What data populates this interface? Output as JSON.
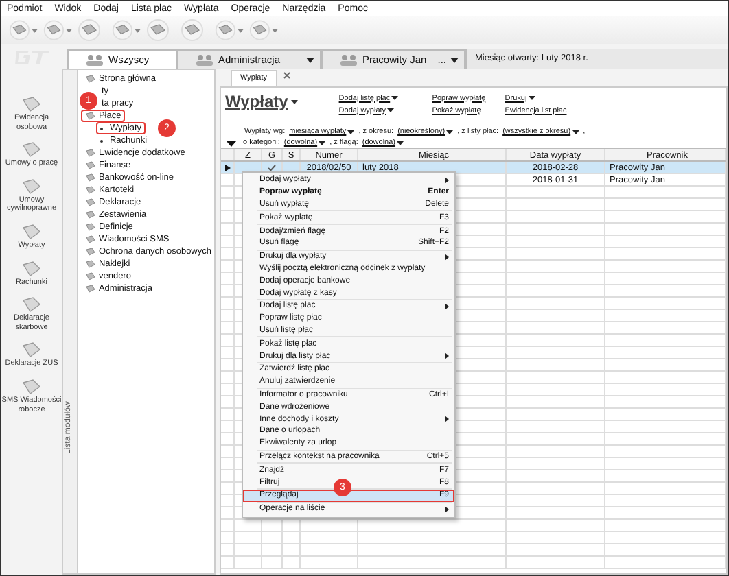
{
  "menu_bar": [
    "Podmiot",
    "Widok",
    "Dodaj",
    "Lista płac",
    "Wypłata",
    "Operacje",
    "Narzędzia",
    "Pomoc"
  ],
  "toolbar": [
    {
      "dropdown": true
    },
    {
      "dropdown": true
    },
    {
      "dropdown": false
    },
    {
      "dropdown": true
    },
    {
      "dropdown": false
    },
    {
      "dropdown": false
    },
    {
      "dropdown": true
    },
    {
      "dropdown": true
    }
  ],
  "context_tabs": [
    {
      "label": "Wszyscy",
      "selected": true,
      "dropdown": false
    },
    {
      "label": "Administracja",
      "selected": false,
      "dropdown": true
    },
    {
      "label": "Pracowity Jan",
      "selected": false,
      "dropdown": true,
      "more": "..."
    }
  ],
  "open_month": "Miesiąc otwarty: Luty 2018 r.",
  "left_nav": [
    {
      "label": "Ewidencja osobowa"
    },
    {
      "label": "Umowy o pracę"
    },
    {
      "label": "Umowy cywilnoprawne"
    },
    {
      "label": "Wypłaty"
    },
    {
      "label": "Rachunki"
    },
    {
      "label": "Deklaracje skarbowe"
    },
    {
      "label": "Deklaracje ZUS"
    },
    {
      "label": "SMS Wiadomości robocze"
    }
  ],
  "module_list": {
    "title": "Lista modułów",
    "items": [
      {
        "label": "Strona główna"
      },
      {
        "label": "ty"
      },
      {
        "label": "ta pracy"
      },
      {
        "label": "Płace",
        "expanded": true,
        "callout": "1",
        "children": [
          {
            "label": "Wypłaty",
            "callout": "2"
          },
          {
            "label": "Rachunki"
          }
        ]
      },
      {
        "label": "Ewidencje dodatkowe"
      },
      {
        "label": "Finanse"
      },
      {
        "label": "Bankowość on-line"
      },
      {
        "label": "Kartoteki"
      },
      {
        "label": "Deklaracje"
      },
      {
        "label": "Zestawienia"
      },
      {
        "label": "Definicje"
      },
      {
        "label": "Wiadomości SMS"
      },
      {
        "label": "Ochrona danych osobowych"
      },
      {
        "label": "Naklejki"
      },
      {
        "label": "vendero"
      },
      {
        "label": "Administracja"
      }
    ]
  },
  "document_tab": {
    "label": "Wypłaty"
  },
  "page": {
    "title": "Wypłaty",
    "actions": [
      {
        "label": "Dodaj listę płac",
        "dropdown": true
      },
      {
        "label": "Dodaj wypłaty",
        "dropdown": true
      },
      {
        "label": "Popraw wypłatę",
        "dropdown": false
      },
      {
        "label": "Pokaż wypłatę",
        "dropdown": false
      },
      {
        "label": "Drukuj",
        "dropdown": true
      },
      {
        "label": "Ewidencja list płac",
        "dropdown": false
      }
    ]
  },
  "filters": [
    [
      {
        "text": "Wypłaty wg:"
      },
      {
        "link": "miesiąca wypłaty"
      },
      {
        "text": ", z okresu:"
      },
      {
        "link": "(nieokreślony)"
      },
      {
        "text": ", z listy płac:"
      },
      {
        "link": "(wszystkie z okresu)"
      },
      {
        "text": ","
      }
    ],
    [
      {
        "text": "o kategorii:"
      },
      {
        "link": "(dowolna)"
      },
      {
        "text": ", z flagą:"
      },
      {
        "link": "(dowolna)"
      }
    ]
  ],
  "table": {
    "columns": [
      "Z",
      "G",
      "S",
      "Numer",
      "Miesiąc",
      "Data wypłaty",
      "Pracownik"
    ],
    "rows": [
      {
        "selected": true,
        "g_checked": true,
        "number": "2018/02/50",
        "month": "luty 2018",
        "date": "2018-02-28",
        "employee": "Pracowity Jan"
      },
      {
        "selected": false,
        "date": "2018-01-31",
        "employee": "Pracowity Jan"
      }
    ]
  },
  "context_menu": [
    {
      "kind": "item",
      "label": "Dodaj wypłaty",
      "submenu": true
    },
    {
      "kind": "item",
      "label": "Popraw wypłatę",
      "shortcut": "Enter",
      "bold": true
    },
    {
      "kind": "item",
      "label": "Usuń wypłatę",
      "shortcut": "Delete"
    },
    {
      "kind": "separator"
    },
    {
      "kind": "item",
      "label": "Pokaż wypłatę",
      "shortcut": "F3"
    },
    {
      "kind": "separator"
    },
    {
      "kind": "item",
      "label": "Dodaj/zmień flagę",
      "shortcut": "F2"
    },
    {
      "kind": "item",
      "label": "Usuń flagę",
      "shortcut": "Shift+F2"
    },
    {
      "kind": "separator"
    },
    {
      "kind": "item",
      "label": "Drukuj dla wypłaty",
      "submenu": true
    },
    {
      "kind": "item",
      "label": "Wyślij pocztą elektroniczną odcinek z wypłaty"
    },
    {
      "kind": "item",
      "label": "Dodaj operacje bankowe"
    },
    {
      "kind": "item",
      "label": "Dodaj wypłatę z kasy"
    },
    {
      "kind": "separator"
    },
    {
      "kind": "item",
      "label": "Dodaj listę płac",
      "submenu": true
    },
    {
      "kind": "item",
      "label": "Popraw listę płac"
    },
    {
      "kind": "item",
      "label": "Usuń listę płac"
    },
    {
      "kind": "separator"
    },
    {
      "kind": "item",
      "label": "Pokaż listę płac"
    },
    {
      "kind": "item",
      "label": "Drukuj dla listy płac",
      "submenu": true
    },
    {
      "kind": "separator"
    },
    {
      "kind": "item",
      "label": "Zatwierdź listę płac"
    },
    {
      "kind": "item",
      "label": "Anuluj zatwierdzenie"
    },
    {
      "kind": "separator"
    },
    {
      "kind": "item",
      "label": "Informator o pracowniku",
      "shortcut": "Ctrl+I"
    },
    {
      "kind": "item",
      "label": "Dane wdrożeniowe"
    },
    {
      "kind": "item",
      "label": "Inne dochody i koszty",
      "submenu": true
    },
    {
      "kind": "item",
      "label": "Dane o urlopach"
    },
    {
      "kind": "item",
      "label": "Ekwiwalenty za urlop"
    },
    {
      "kind": "separator"
    },
    {
      "kind": "item",
      "label": "Przełącz kontekst na pracownika",
      "shortcut": "Ctrl+5"
    },
    {
      "kind": "separator"
    },
    {
      "kind": "item",
      "label": "Znajdź",
      "shortcut": "F7"
    },
    {
      "kind": "item",
      "label": "Filtruj",
      "shortcut": "F8"
    },
    {
      "kind": "separator"
    },
    {
      "kind": "item",
      "label": "Przeglądaj",
      "shortcut": "F9",
      "selected": true,
      "callout": "3"
    },
    {
      "kind": "separator"
    },
    {
      "kind": "item",
      "label": "Operacje na liście",
      "submenu": true
    }
  ]
}
